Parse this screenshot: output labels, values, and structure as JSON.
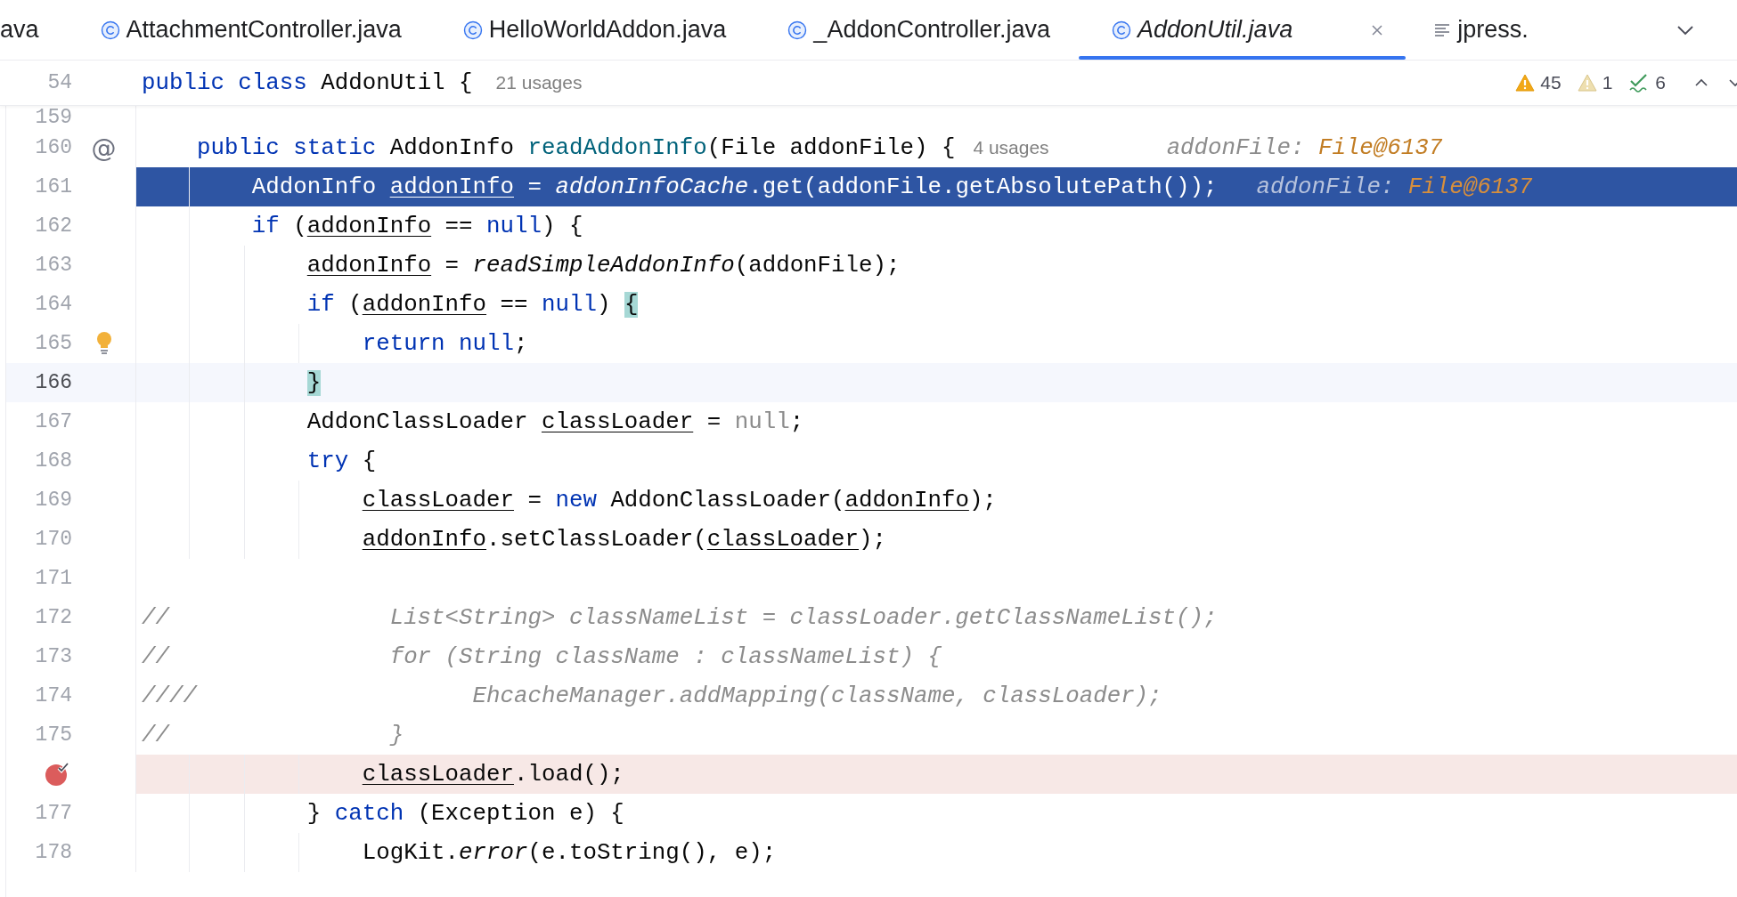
{
  "tabs": [
    {
      "label": "ava",
      "selected": false
    },
    {
      "label": "AttachmentController.java",
      "kind": "class",
      "selected": false
    },
    {
      "label": "HelloWorldAddon.java",
      "kind": "class",
      "selected": false
    },
    {
      "label": "_AddonController.java",
      "kind": "class",
      "selected": false
    },
    {
      "label": "AddonUtil.java",
      "kind": "class",
      "selected": true,
      "preview": true
    },
    {
      "label": "jpress.",
      "kind": "text",
      "selected": false
    }
  ],
  "sticky_header": {
    "number": "54",
    "tokens": [
      {
        "text": "public class",
        "kind": "kw"
      },
      {
        "text": " AddonUtil {",
        "kind": "plain"
      }
    ],
    "usages": "21 usages"
  },
  "inspections": [
    {
      "kind": "warning",
      "count": "45"
    },
    {
      "kind": "weak-warning",
      "count": "1"
    },
    {
      "kind": "typo",
      "count": "6"
    }
  ],
  "lines": [
    {
      "number": "159",
      "kind": "code"
    },
    {
      "number": "160",
      "kind": "code",
      "gutter": {
        "kind": "symbol",
        "text": "@"
      },
      "tokens": [
        {
          "text": "    public static",
          "kind": "kw"
        },
        {
          "text": " AddonInfo ",
          "kind": "plain"
        },
        {
          "text": "readAddonInfo",
          "kind": "decl"
        },
        {
          "text": "(File addonFile) {",
          "kind": "plain"
        }
      ],
      "usages": "4 usages",
      "value_hint": {
        "name": "addonFile:",
        "value": "File@6137"
      }
    },
    {
      "number": "161",
      "kind": "execution",
      "tokens": [
        {
          "text": "        AddonInfo ",
          "kind": "plain"
        },
        {
          "text": "addonInfo",
          "kind": "var"
        },
        {
          "text": " = ",
          "kind": "plain"
        },
        {
          "text": "addonInfoCache",
          "kind": "static"
        },
        {
          "text": ".get(addonFile.getAbsolutePath());",
          "kind": "plain"
        }
      ],
      "value_hint": {
        "name": "addonFile:",
        "value": "File@6137"
      }
    },
    {
      "number": "162",
      "kind": "code",
      "tokens": [
        {
          "text": "        if",
          "kind": "kw"
        },
        {
          "text": " (",
          "kind": "plain"
        },
        {
          "text": "addonInfo",
          "kind": "var"
        },
        {
          "text": " == ",
          "kind": "plain"
        },
        {
          "text": "null",
          "kind": "kw"
        },
        {
          "text": ") {",
          "kind": "plain"
        }
      ]
    },
    {
      "number": "163",
      "kind": "code",
      "tokens": [
        {
          "text": "            addonInfo",
          "kind": "var"
        },
        {
          "text": " = ",
          "kind": "plain"
        },
        {
          "text": "readSimpleAddonInfo",
          "kind": "static"
        },
        {
          "text": "(addonFile);",
          "kind": "plain"
        }
      ]
    },
    {
      "number": "164",
      "kind": "code",
      "tokens": [
        {
          "text": "            if",
          "kind": "kw"
        },
        {
          "text": " (",
          "kind": "plain"
        },
        {
          "text": "addonInfo",
          "kind": "var"
        },
        {
          "text": " == ",
          "kind": "plain"
        },
        {
          "text": "null",
          "kind": "kw"
        },
        {
          "text": ") ",
          "kind": "plain"
        },
        {
          "text": "{",
          "kind": "brace"
        }
      ]
    },
    {
      "number": "165",
      "kind": "code",
      "gutter": {
        "kind": "bulb"
      },
      "tokens": [
        {
          "text": "                return null",
          "kind": "kw"
        },
        {
          "text": ";",
          "kind": "plain"
        }
      ]
    },
    {
      "number": "166",
      "kind": "caret",
      "tokens": [
        {
          "text": "            }",
          "kind": "brace"
        }
      ]
    },
    {
      "number": "167",
      "kind": "code",
      "tokens": [
        {
          "text": "            AddonClassLoader ",
          "kind": "plain"
        },
        {
          "text": "classLoader",
          "kind": "var"
        },
        {
          "text": " = ",
          "kind": "plain"
        },
        {
          "text": "null",
          "kind": "dim"
        },
        {
          "text": ";",
          "kind": "plain"
        }
      ]
    },
    {
      "number": "168",
      "kind": "code",
      "tokens": [
        {
          "text": "            try",
          "kind": "kw"
        },
        {
          "text": " {",
          "kind": "plain"
        }
      ]
    },
    {
      "number": "169",
      "kind": "code",
      "tokens": [
        {
          "text": "                classLoader",
          "kind": "var"
        },
        {
          "text": " = ",
          "kind": "plain"
        },
        {
          "text": "new",
          "kind": "kw"
        },
        {
          "text": " AddonClassLoader(",
          "kind": "plain"
        },
        {
          "text": "addonInfo",
          "kind": "var"
        },
        {
          "text": ");",
          "kind": "plain"
        }
      ]
    },
    {
      "number": "170",
      "kind": "code",
      "tokens": [
        {
          "text": "                addonInfo",
          "kind": "var"
        },
        {
          "text": ".setClassLoader(",
          "kind": "plain"
        },
        {
          "text": "classLoader",
          "kind": "var"
        },
        {
          "text": ");",
          "kind": "plain"
        }
      ]
    },
    {
      "number": "171",
      "kind": "code"
    },
    {
      "number": "172",
      "kind": "code",
      "tokens": [
        {
          "text": "//                List<String> classNameList = classLoader.getClassNameList();",
          "kind": "comment"
        }
      ]
    },
    {
      "number": "173",
      "kind": "code",
      "tokens": [
        {
          "text": "//                for (String className : classNameList) {",
          "kind": "comment"
        }
      ]
    },
    {
      "number": "174",
      "kind": "code",
      "tokens": [
        {
          "text": "////                    EhcacheManager.addMapping(className, classLoader);",
          "kind": "comment"
        }
      ]
    },
    {
      "number": "175",
      "kind": "code",
      "tokens": [
        {
          "text": "//                }",
          "kind": "comment"
        }
      ]
    },
    {
      "kind": "breakpoint",
      "gutter": {
        "kind": "breakpoint"
      },
      "tokens": [
        {
          "text": "                classLoader",
          "kind": "var"
        },
        {
          "text": ".load();",
          "kind": "plain"
        }
      ]
    },
    {
      "number": "177",
      "kind": "code",
      "tokens": [
        {
          "text": "            } ",
          "kind": "plain"
        },
        {
          "text": "catch",
          "kind": "kw"
        },
        {
          "text": " (Exception e) {",
          "kind": "plain"
        }
      ]
    },
    {
      "number": "178",
      "kind": "code",
      "tokens": [
        {
          "text": "                LogKit.",
          "kind": "plain"
        },
        {
          "text": "error",
          "kind": "static"
        },
        {
          "text": "(e.toString(), e);",
          "kind": "plain"
        }
      ]
    }
  ]
}
